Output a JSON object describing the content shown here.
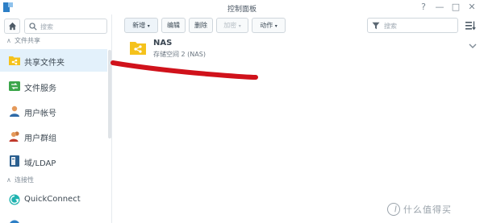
{
  "window": {
    "title": "控制面板",
    "help": "?",
    "minimize": "—",
    "maximize": "□",
    "close": "✕"
  },
  "sidebar": {
    "search_placeholder": "搜索",
    "sections": [
      {
        "label": "文件共享",
        "items": [
          {
            "label": "共享文件夹",
            "icon": "shared-folder-icon",
            "active": true
          },
          {
            "label": "文件服务",
            "icon": "file-services-icon"
          },
          {
            "label": "用户帐号",
            "icon": "user-icon"
          },
          {
            "label": "用户群组",
            "icon": "group-icon"
          },
          {
            "label": "域/LDAP",
            "icon": "domain-ldap-icon"
          }
        ]
      },
      {
        "label": "连接性",
        "items": [
          {
            "label": "QuickConnect",
            "icon": "quickconnect-icon"
          }
        ]
      }
    ]
  },
  "toolbar": {
    "create": "新增",
    "edit": "编辑",
    "delete": "删除",
    "encrypt": "加密",
    "action": "动作",
    "filter_placeholder": "搜索"
  },
  "shares": [
    {
      "name": "NAS",
      "subtitle": "存储空间 2 (NAS)"
    }
  ],
  "watermark": {
    "text": "什么值得买"
  },
  "colors": {
    "accent": "#2d7fc6",
    "active_bg": "#e3f1fb",
    "folder": "#f5c21b",
    "scribble": "#d0121b"
  }
}
